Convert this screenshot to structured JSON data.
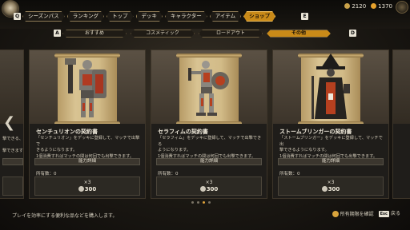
{
  "currency": {
    "primary_amount": "2120",
    "secondary_amount": "1370",
    "primary_color": "#c9a24a",
    "secondary_color": "#e6a12c"
  },
  "nav": {
    "left_key": "Q",
    "right_key": "E",
    "tabs": [
      "シーズンパス",
      "ランキング",
      "トップ",
      "デッキ",
      "キャラクター",
      "アイテム",
      "ショップ"
    ],
    "active_tab": "ショップ"
  },
  "subnav": {
    "left_key": "A",
    "right_key": "D",
    "tabs": [
      "おすすめ",
      "コスメティック",
      "ロードアウト",
      "その他"
    ],
    "active_tab": "その他"
  },
  "cards": [
    {
      "title": "センチュリオンの契約書",
      "desc_line1": "「センチュリオン」をデッキに登録して、マッチで出撃で",
      "desc_line2": "きるようになります。",
      "desc_line3": "1個消費すればマッチの間は何回でも出撃できます。",
      "detail_label": "能力詳細",
      "owned_label": "所有数：0",
      "qty": "×3",
      "price": "300",
      "figure": "centurion"
    },
    {
      "title": "セラフィムの契約書",
      "desc_line1": "「セラフィム」をデッキに登録して、マッチで出撃できる",
      "desc_line2": "ようになります。",
      "desc_line3": "1個消費すればマッチの間は何回でも出撃できます。",
      "detail_label": "能力詳細",
      "owned_label": "所有数：0",
      "qty": "×3",
      "price": "300",
      "figure": "seraphim"
    },
    {
      "title": "ストームブリンガーの契約書",
      "desc_line1": "「ストームブリンガー」をデッキに登録して、マッチで出",
      "desc_line2": "撃できるようになります。",
      "desc_line3": "1個消費すればマッチの間は何回でも出撃できます。",
      "detail_label": "能力詳細",
      "owned_label": "所有数：0",
      "qty": "×3",
      "price": "300",
      "figure": "stormbringer"
    }
  ],
  "left_partial": {
    "desc_line1": "、マッチで出撃できる",
    "desc_line3": "撃できます。",
    "owned_label": "",
    "qty": "×3",
    "price": "300"
  },
  "pagination": {
    "count": 4,
    "active_index": 2
  },
  "footer": {
    "hint": "プレイを効率にする便利な品などを購入します。",
    "confirm_label": "所有期限を確認",
    "back_key": "Esc",
    "back_label": "戻る"
  }
}
